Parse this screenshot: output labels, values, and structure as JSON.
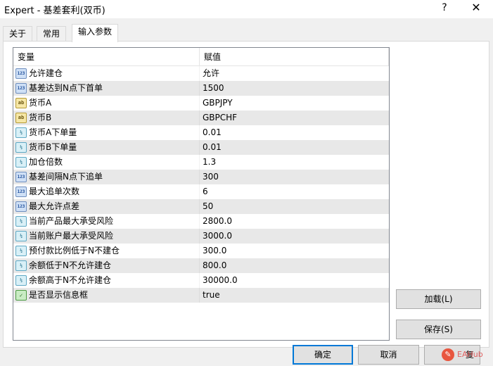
{
  "window": {
    "title": "Expert - 基差套利(双币)",
    "help": "?",
    "close": "✕"
  },
  "tabs": [
    {
      "label": "关于"
    },
    {
      "label": "常用"
    },
    {
      "label": "输入参数",
      "active": true
    }
  ],
  "table": {
    "columns": {
      "name": "变量",
      "value": "赋值"
    },
    "rows": [
      {
        "icon": "integer-icon",
        "icon_text": "123",
        "name": "允许建仓",
        "value": "允许"
      },
      {
        "icon": "integer-icon",
        "icon_text": "123",
        "name": "基差达到N点下首单",
        "value": "1500"
      },
      {
        "icon": "string-icon",
        "icon_text": "ab",
        "name": "货币A",
        "value": "GBPJPY"
      },
      {
        "icon": "string-icon",
        "icon_text": "ab",
        "name": "货币B",
        "value": "GBPCHF"
      },
      {
        "icon": "double-icon",
        "icon_text": "½",
        "name": "货币A下单量",
        "value": "0.01"
      },
      {
        "icon": "double-icon",
        "icon_text": "½",
        "name": "货币B下单量",
        "value": "0.01"
      },
      {
        "icon": "double-icon",
        "icon_text": "½",
        "name": "加仓倍数",
        "value": "1.3"
      },
      {
        "icon": "integer-icon",
        "icon_text": "123",
        "name": "基差间隔N点下追单",
        "value": "300"
      },
      {
        "icon": "integer-icon",
        "icon_text": "123",
        "name": "最大追单次数",
        "value": "6"
      },
      {
        "icon": "integer-icon",
        "icon_text": "123",
        "name": "最大允许点差",
        "value": "50"
      },
      {
        "icon": "double-icon",
        "icon_text": "½",
        "name": "当前产品最大承受风险",
        "value": "2800.0"
      },
      {
        "icon": "double-icon",
        "icon_text": "½",
        "name": "当前账户最大承受风险",
        "value": "3000.0"
      },
      {
        "icon": "double-icon",
        "icon_text": "½",
        "name": "预付款比例低于N不建仓",
        "value": "300.0"
      },
      {
        "icon": "double-icon",
        "icon_text": "½",
        "name": "余额低于N不允许建仓",
        "value": "800.0"
      },
      {
        "icon": "double-icon",
        "icon_text": "½",
        "name": "余额高于N不允许建仓",
        "value": "30000.0"
      },
      {
        "icon": "boolean-icon",
        "icon_text": "✓",
        "name": "是否显示信息框",
        "value": "true"
      }
    ]
  },
  "buttons": {
    "load": "加载(L)",
    "save": "保存(S)",
    "ok": "确定",
    "cancel": "取消",
    "reset": "复"
  },
  "watermark": {
    "logo": "✎",
    "text": "EAHub"
  }
}
